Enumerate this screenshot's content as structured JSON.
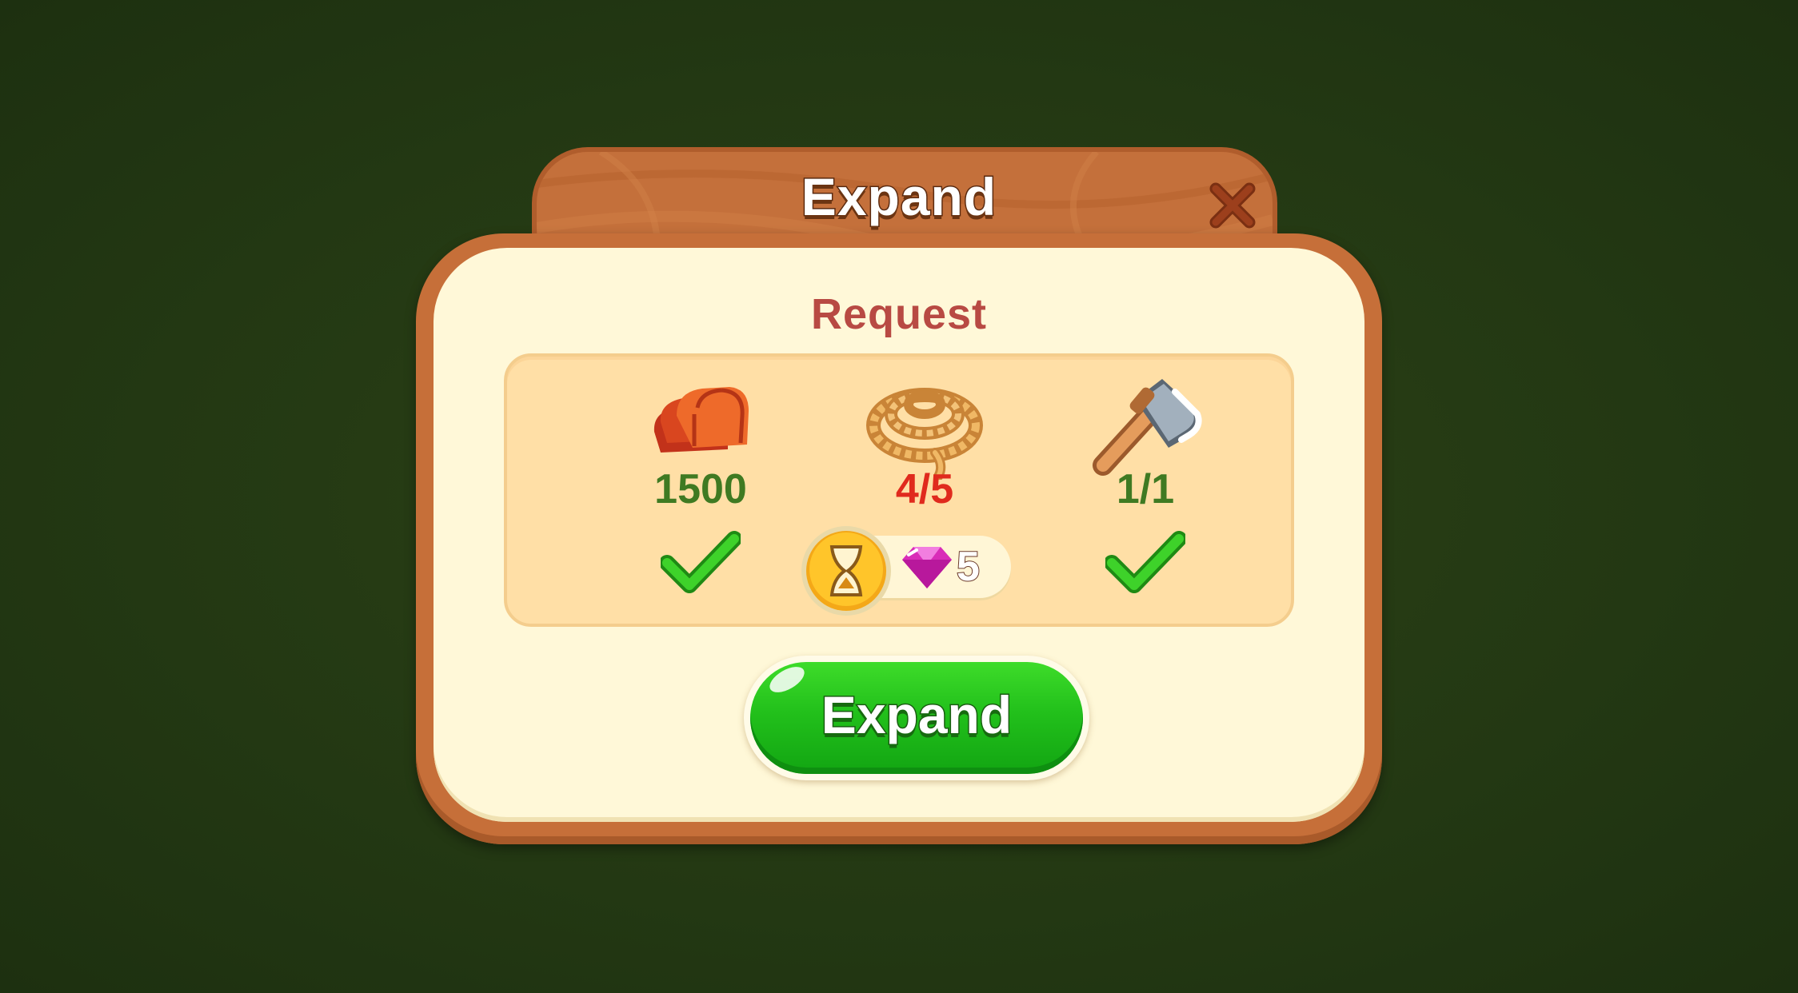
{
  "dialog": {
    "title": "Expand",
    "section_label": "Request",
    "items": [
      {
        "name": "tiles",
        "icon": "roof-tiles-icon",
        "count_text": "1500",
        "fulfilled": true
      },
      {
        "name": "rope",
        "icon": "rope-icon",
        "count_text": "4/5",
        "fulfilled": false,
        "speedup": {
          "icon": "hourglass-icon",
          "currency_icon": "gem-icon",
          "cost": "5"
        }
      },
      {
        "name": "axe",
        "icon": "axe-icon",
        "count_text": "1/1",
        "fulfilled": true
      }
    ],
    "confirm_button_label": "Expand",
    "close_icon": "close-icon"
  },
  "colors": {
    "background": "#243913",
    "frame": "#c66f39",
    "panel": "#fff8d8",
    "request_box": "#ffdfa6",
    "request_label": "#b84a43",
    "count_ok": "#3f7a22",
    "count_missing": "#e02a1d",
    "button_green": "#22c01b",
    "gem": "#e63cc8"
  }
}
